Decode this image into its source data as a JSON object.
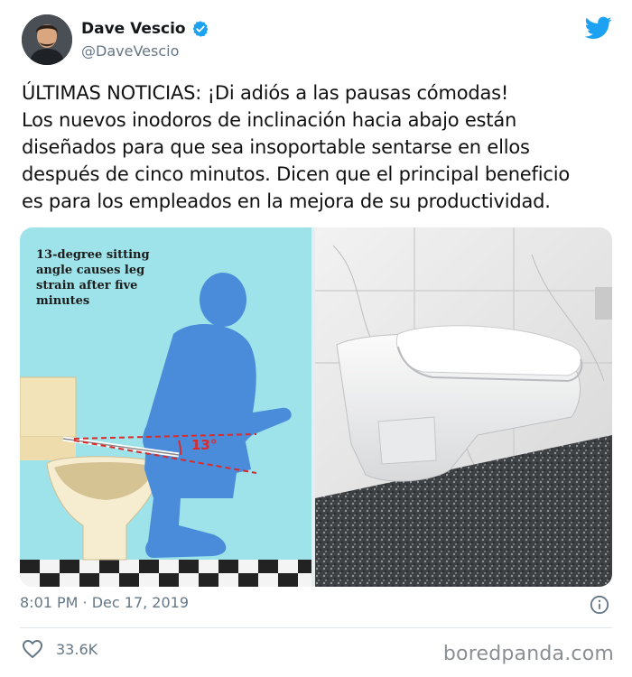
{
  "author": {
    "name": "Dave Vescio",
    "handle": "@DaveVescio"
  },
  "tweet": {
    "text": "ÚLTIMAS NOTICIAS: ¡Di adiós a las pausas cómodas!\nLos nuevos inodoros de inclinación hacia abajo están\ndiseñados para que sea insoportable sentarse en ellos\ndespués de cinco minutos. Dicen que el principal beneficio\nes para los empleados en la mejora de su productividad.",
    "timestamp": "8:01 PM · Dec 17, 2019",
    "likes": "33.6K"
  },
  "media": {
    "illustration_caption": "13-degree sitting\nangle causes leg\nstrain after five\nminutes",
    "angle_label": "13°"
  },
  "watermark": "boredpanda.com",
  "colors": {
    "brand_blue": "#1da1f2",
    "muted_text": "#657786",
    "angle_red": "#d92b2b",
    "illustration_bg": "#9fe3ea",
    "silhouette": "#4a8cd9"
  },
  "icons": [
    "verified-badge-icon",
    "twitter-bird-icon",
    "info-icon",
    "heart-icon"
  ]
}
